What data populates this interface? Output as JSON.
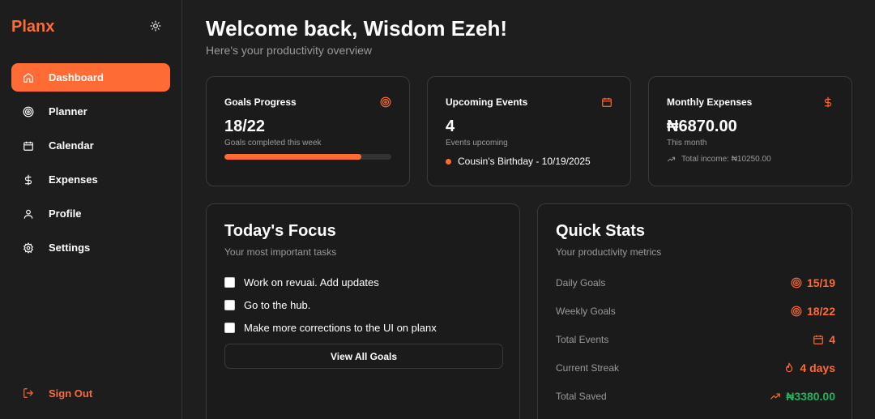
{
  "brand": "Planx",
  "sidebar": {
    "items": [
      {
        "label": "Dashboard",
        "icon": "home-icon",
        "active": true
      },
      {
        "label": "Planner",
        "icon": "target-icon"
      },
      {
        "label": "Calendar",
        "icon": "calendar-icon"
      },
      {
        "label": "Expenses",
        "icon": "dollar-icon"
      },
      {
        "label": "Profile",
        "icon": "user-icon"
      },
      {
        "label": "Settings",
        "icon": "gear-icon"
      }
    ],
    "signout": "Sign Out"
  },
  "header": {
    "title": "Welcome back, Wisdom Ezeh!",
    "subtitle": "Here's your productivity overview"
  },
  "cards": {
    "goals": {
      "label": "Goals Progress",
      "value": "18/22",
      "sub": "Goals completed this week",
      "progress": 0.82
    },
    "events": {
      "label": "Upcoming Events",
      "value": "4",
      "sub": "Events upcoming",
      "event": "Cousin's Birthday - 10/19/2025"
    },
    "expenses": {
      "label": "Monthly Expenses",
      "value": "₦6870.00",
      "sub": "This month",
      "income": "Total income: ₦10250.00"
    }
  },
  "focus": {
    "title": "Today's Focus",
    "subtitle": "Your most important tasks",
    "tasks": [
      "Work on revuai. Add updates",
      "Go to the hub.",
      "Make more corrections to the UI on planx"
    ],
    "button": "View All Goals"
  },
  "quick_stats": {
    "title": "Quick Stats",
    "subtitle": "Your productivity metrics",
    "rows": [
      {
        "label": "Daily Goals",
        "value": "15/19",
        "icon": "target-icon",
        "color": "#ff6b35"
      },
      {
        "label": "Weekly Goals",
        "value": "18/22",
        "icon": "target-icon",
        "color": "#ff6b35"
      },
      {
        "label": "Total Events",
        "value": "4",
        "icon": "calendar-icon",
        "color": "#ff6b35"
      },
      {
        "label": "Current Streak",
        "value": "4 days",
        "icon": "flame-icon",
        "color": "#ff6b35"
      },
      {
        "label": "Total Saved",
        "value": "₦3380.00",
        "icon": "trending-up-icon",
        "color": "#22b35a"
      }
    ]
  },
  "colors": {
    "accent": "#ff6b35",
    "positive": "#22b35a",
    "background": "#1e1e1e"
  }
}
